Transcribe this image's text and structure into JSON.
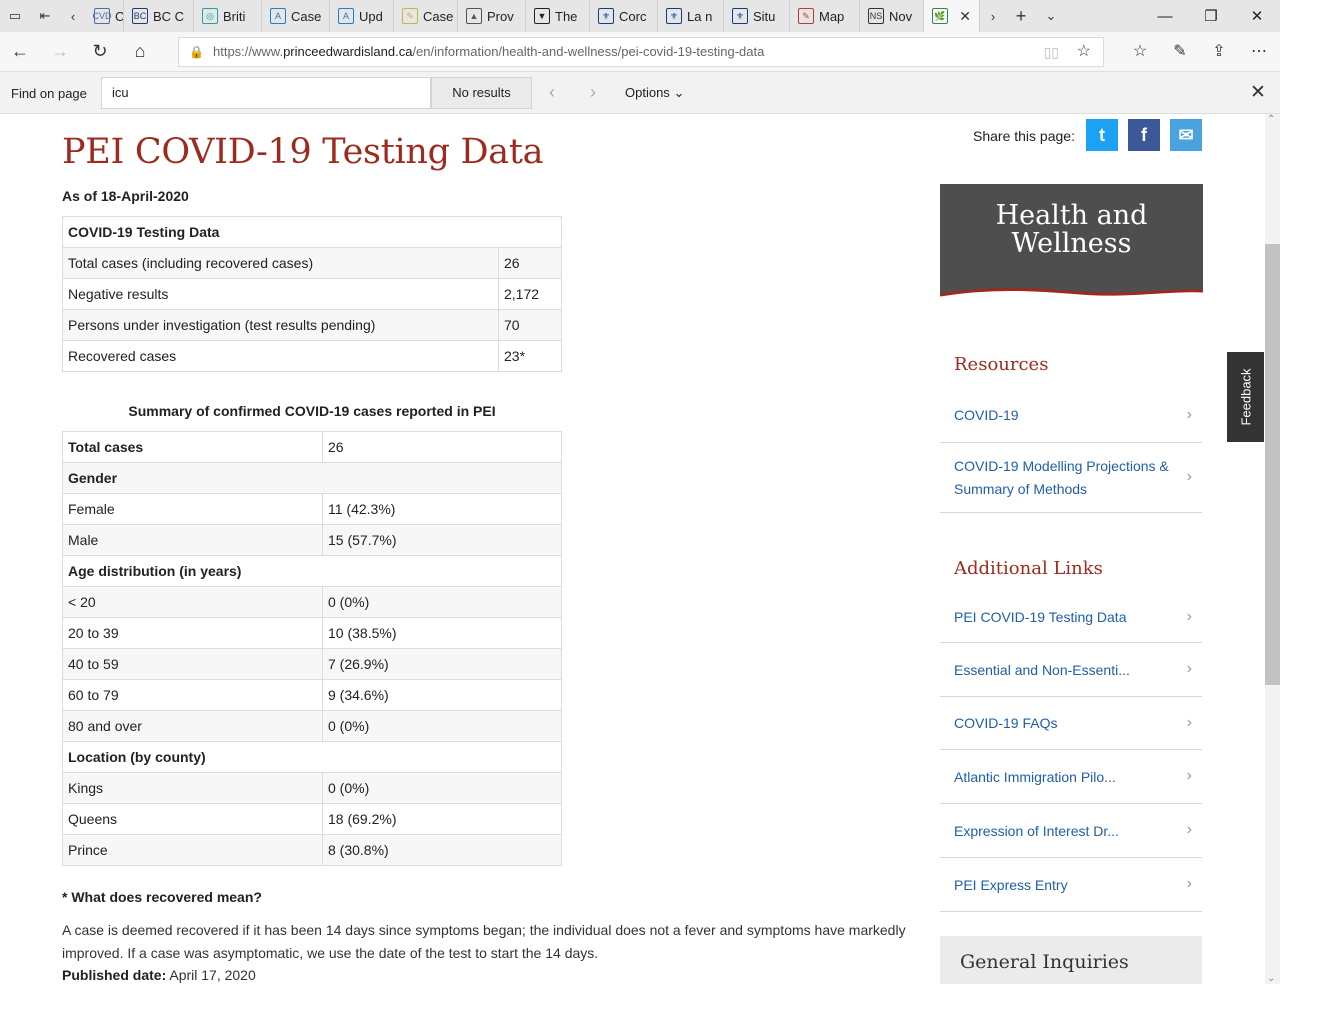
{
  "browser": {
    "tabs": [
      {
        "label": "Corc",
        "favicon": "CVD",
        "color": "#4a6da7"
      },
      {
        "label": "BC C",
        "favicon": "BC",
        "color": "#1f3c73"
      },
      {
        "label": "Briti",
        "favicon": "◎",
        "color": "#1fa3a3"
      },
      {
        "label": "Case",
        "favicon": "A",
        "color": "#2a7bbf"
      },
      {
        "label": "Upd",
        "favicon": "A",
        "color": "#2a7bbf"
      },
      {
        "label": "Case",
        "favicon": "✎",
        "color": "#c9b24a"
      },
      {
        "label": "Prov",
        "favicon": "▲",
        "color": "#555555"
      },
      {
        "label": "The",
        "favicon": "▼",
        "color": "#222222"
      },
      {
        "label": "Corc",
        "favicon": "⚜",
        "color": "#0b3d91"
      },
      {
        "label": "La n",
        "favicon": "⚜",
        "color": "#0b3d91"
      },
      {
        "label": "Situ",
        "favicon": "⚜",
        "color": "#0b3d91"
      },
      {
        "label": "Map",
        "favicon": "✎",
        "color": "#c0392b"
      },
      {
        "label": "Nov",
        "favicon": "NS",
        "color": "#333333"
      },
      {
        "label": "",
        "favicon": "🌿",
        "color": "#2d8a4e"
      }
    ],
    "url_prefix": "https://www.",
    "url_domain": "princeedwardisland.ca",
    "url_path": "/en/information/health-and-wellness/pei-covid-19-testing-data"
  },
  "find_bar": {
    "label": "Find on page",
    "query": "icu",
    "result": "No results",
    "options": "Options"
  },
  "page": {
    "title": "PEI COVID-19 Testing Data",
    "as_of": "As of 18-April-2020",
    "testing_table": {
      "header": "COVID-19 Testing Data",
      "rows": [
        {
          "label": "Total cases (including recovered cases)",
          "value": "26"
        },
        {
          "label": "Negative results",
          "value": "2,172"
        },
        {
          "label": "Persons under investigation (test results pending)",
          "value": "70"
        },
        {
          "label": "Recovered cases",
          "value": "23*"
        }
      ]
    },
    "summary_caption": "Summary of confirmed COVID-19 cases reported in PEI",
    "summary_table": {
      "total_label": "Total cases",
      "total_value": "26",
      "gender_header": "Gender",
      "gender": [
        {
          "label": "Female",
          "value": "11 (42.3%)"
        },
        {
          "label": "Male",
          "value": "15 (57.7%)"
        }
      ],
      "age_header": "Age distribution (in years)",
      "age": [
        {
          "label": "< 20",
          "value": "0 (0%)"
        },
        {
          "label": "20 to 39",
          "value": "10 (38.5%)"
        },
        {
          "label": "40 to 59",
          "value": "7 (26.9%)"
        },
        {
          "label": "60 to 79",
          "value": "9 (34.6%)"
        },
        {
          "label": "80 and over",
          "value": "0 (0%)"
        }
      ],
      "location_header": "Location (by county)",
      "location": [
        {
          "label": "Kings",
          "value": "0 (0%)"
        },
        {
          "label": "Queens",
          "value": "18 (69.2%)"
        },
        {
          "label": "Prince",
          "value": "8 (30.8%)"
        }
      ]
    },
    "recovered_question": "* What does recovered mean?",
    "recovered_text": "A case is deemed recovered if it has been 14 days since symptoms began; the individual does not a fever and symptoms have markedly improved. If a case was asymptomatic, we use the date of the test to start the 14 days.",
    "published_label": "Published date:",
    "published_value": "April 17, 2020"
  },
  "sidebar": {
    "share_label": "Share this page:",
    "share_buttons": [
      {
        "name": "twitter",
        "glyph": "t",
        "color": "#1da1f2"
      },
      {
        "name": "facebook",
        "glyph": "f",
        "color": "#3b5998"
      },
      {
        "name": "email",
        "glyph": "✉",
        "color": "#4aa3df"
      }
    ],
    "banner_line1": "Health and",
    "banner_line2": "Wellness",
    "resources_heading": "Resources",
    "resources": [
      "COVID-19",
      "COVID-19 Modelling Projections & Summary of Methods"
    ],
    "additional_heading": "Additional Links",
    "additional": [
      "PEI COVID-19 Testing Data",
      "Essential and Non-Essenti...",
      "COVID-19 FAQs",
      "Atlantic Immigration Pilo...",
      "Expression of Interest Dr...",
      "PEI Express Entry"
    ],
    "general_inquiries": "General Inquiries",
    "feedback": "Feedback"
  }
}
